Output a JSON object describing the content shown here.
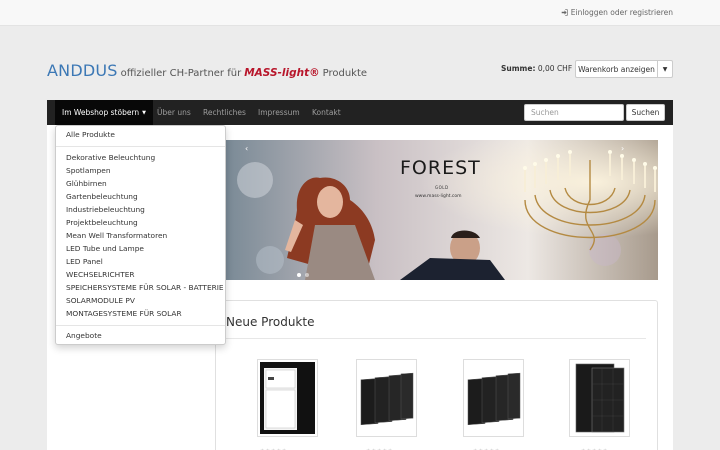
{
  "topbar": {
    "login_label": "Einloggen oder registrieren"
  },
  "brand": {
    "main": "ANDDUS",
    "sub": "offizieller CH-Partner für",
    "mass": "MASS-light®",
    "tail": "Produkte"
  },
  "cart": {
    "sum_label": "Summe:",
    "sum_value": "0,00 CHF",
    "button_label": "Warenkorb anzeigen"
  },
  "nav": {
    "items": [
      "Im Webshop stöbern",
      "Über uns",
      "Rechtliches",
      "Impressum",
      "Kontakt"
    ],
    "search_placeholder": "Suchen",
    "search_button": "Suchen"
  },
  "dropdown": {
    "all": "Alle Produkte",
    "categories": [
      "Dekorative Beleuchtung",
      "Spotlampen",
      "Glühbirnen",
      "Gartenbeleuchtung",
      "Industriebeleuchtung",
      "Projektbeleuchtung",
      "Mean Well Transformatoren",
      "LED Tube und Lampe",
      "LED Panel",
      "WECHSELRICHTER",
      "SPEICHERSYSTEME FÜR SOLAR - BATTERIE",
      "SOLARMODULE PV",
      "MONTAGESYSTEME FÜR SOLAR"
    ],
    "offers": "Angebote"
  },
  "slider": {
    "title": "FOREST",
    "sub1": "GOLD",
    "sub2": "www.mass-light.com",
    "prev": "‹",
    "next": "›"
  },
  "products": {
    "title": "Neue Produkte",
    "stars": "★★★★★"
  },
  "colors": {
    "navbar": "#222222",
    "brand": "#3c78b5",
    "mass": "#b8162b"
  }
}
